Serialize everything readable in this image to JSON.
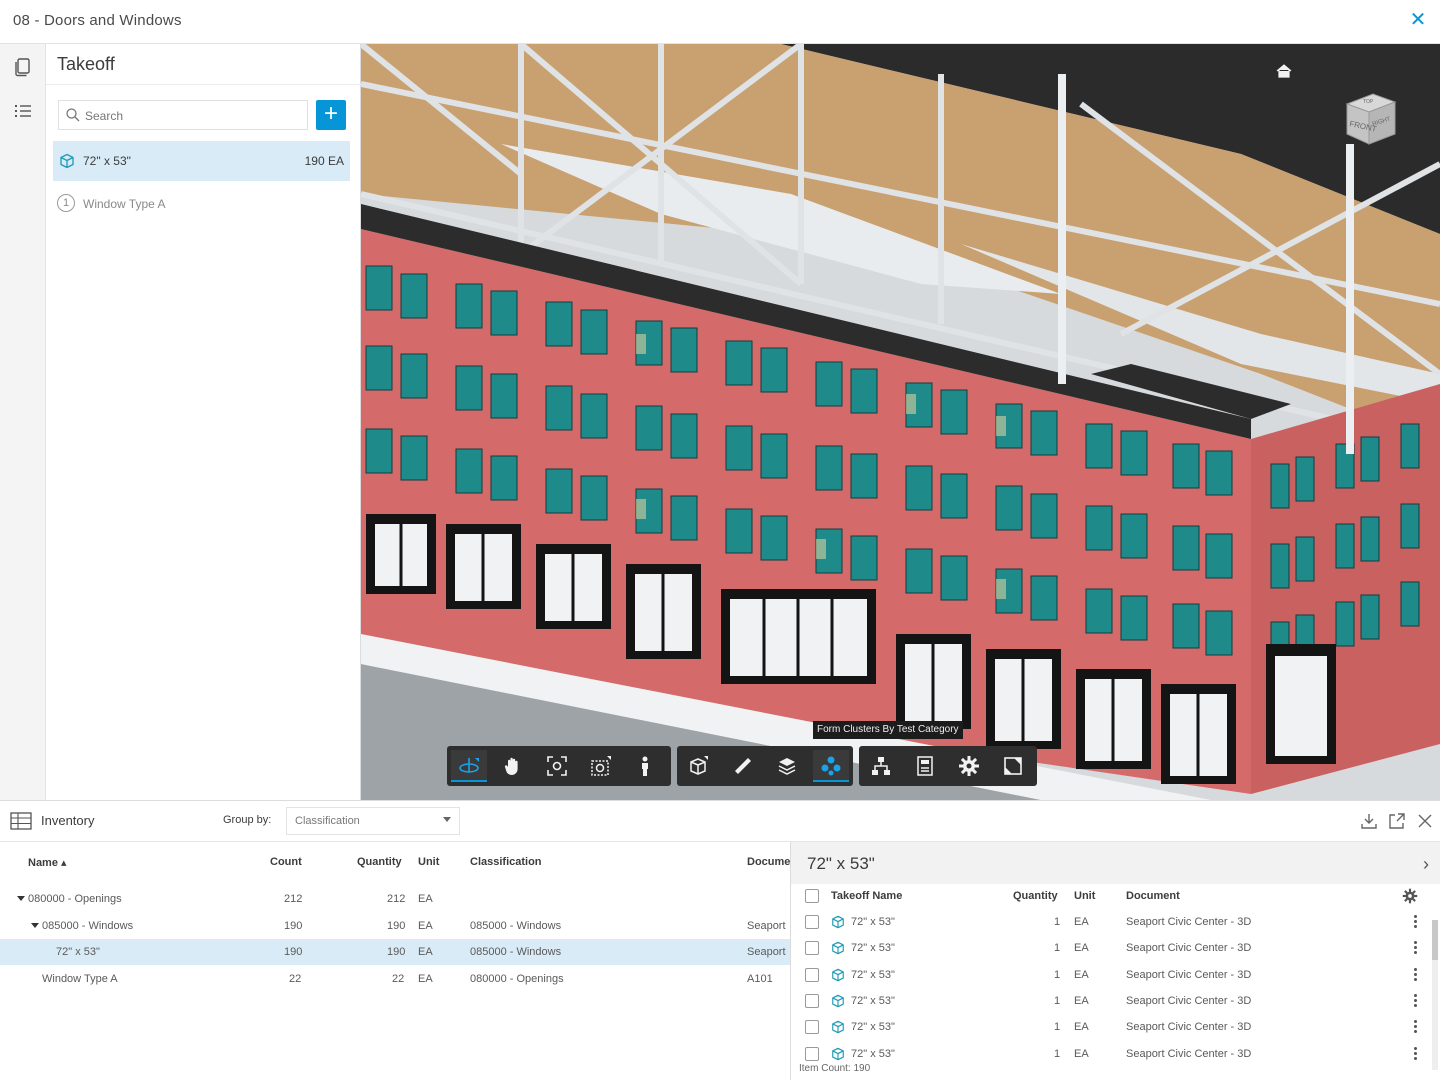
{
  "window": {
    "title": "08 - Doors and Windows"
  },
  "takeoff": {
    "title": "Takeoff",
    "search_placeholder": "Search",
    "items": [
      {
        "name": "72\" x 53\"",
        "quantity": "190 EA",
        "selected": true
      },
      {
        "name": "Window Type A",
        "quantity": ""
      }
    ]
  },
  "viewer": {
    "tooltip": "Form Clusters By Test Category",
    "viewcube_labels": {
      "top": "TOP",
      "front": "FRONT",
      "right": "RIGHT"
    }
  },
  "inventory": {
    "label": "Inventory",
    "group_by_label": "Group by:",
    "group_by_value": "Classification",
    "columns": [
      "Name",
      "Count",
      "Quantity",
      "Unit",
      "Classification",
      "Docume"
    ],
    "rows": [
      {
        "name": "080000 - Openings",
        "count": "212",
        "quantity": "212",
        "unit": "EA",
        "classification": "",
        "document": "",
        "level": 0,
        "expanded": true
      },
      {
        "name": "085000 - Windows",
        "count": "190",
        "quantity": "190",
        "unit": "EA",
        "classification": "085000 - Windows",
        "document": "Seaport",
        "level": 1,
        "expanded": true
      },
      {
        "name": "72\" x 53\"",
        "count": "190",
        "quantity": "190",
        "unit": "EA",
        "classification": "085000 - Windows",
        "document": "Seaport",
        "level": 2,
        "selected": true
      },
      {
        "name": "Window Type A",
        "count": "22",
        "quantity": "22",
        "unit": "EA",
        "classification": "080000 - Openings",
        "document": "A101",
        "level": 1
      }
    ]
  },
  "detail": {
    "title": "72\" x 53\"",
    "columns": [
      "Takeoff Name",
      "Quantity",
      "Unit",
      "Document"
    ],
    "rows": [
      {
        "name": "72\" x 53\"",
        "quantity": "1",
        "unit": "EA",
        "document": "Seaport Civic Center - 3D"
      },
      {
        "name": "72\" x 53\"",
        "quantity": "1",
        "unit": "EA",
        "document": "Seaport Civic Center - 3D"
      },
      {
        "name": "72\" x 53\"",
        "quantity": "1",
        "unit": "EA",
        "document": "Seaport Civic Center - 3D"
      },
      {
        "name": "72\" x 53\"",
        "quantity": "1",
        "unit": "EA",
        "document": "Seaport Civic Center - 3D"
      },
      {
        "name": "72\" x 53\"",
        "quantity": "1",
        "unit": "EA",
        "document": "Seaport Civic Center - 3D"
      },
      {
        "name": "72\" x 53\"",
        "quantity": "1",
        "unit": "EA",
        "document": "Seaport Civic Center - 3D"
      }
    ],
    "item_count": "Item Count: 190"
  },
  "colors": {
    "accent": "#0696d7",
    "selection": "#d9ebf7",
    "facade": "#d46a6a",
    "window_frame": "#1f8a8a"
  }
}
